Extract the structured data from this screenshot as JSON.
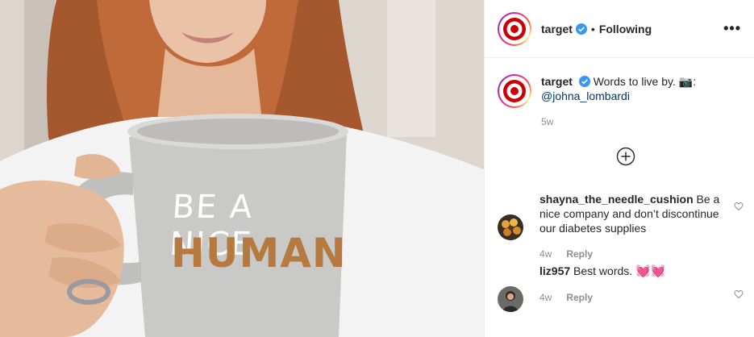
{
  "post": {
    "account": {
      "username": "target",
      "verified": true,
      "follow_status": "Following",
      "separator": "•",
      "more_label": "•••",
      "brand_color": "#cc0000"
    },
    "photo": {
      "mug_line1": "BE A NICE",
      "mug_line2": "HUMAN"
    },
    "caption": {
      "username": "target",
      "text": "Words to live by. 📷:",
      "mention": "@johna_lombardi",
      "age": "5w"
    },
    "load_more_icon": "plus-circle-icon",
    "comments": [
      {
        "username": "shayna_the_needle_cushion",
        "text": "Be a nice company and don’t discontinue our diabetes supplies",
        "age": "4w",
        "reply_label": "Reply",
        "like_icon": "heart-outline-icon"
      },
      {
        "username": "liz957",
        "text": "Best words.",
        "emoji": "💓💓",
        "age": "4w",
        "reply_label": "Reply",
        "like_icon": "heart-outline-icon"
      }
    ]
  }
}
